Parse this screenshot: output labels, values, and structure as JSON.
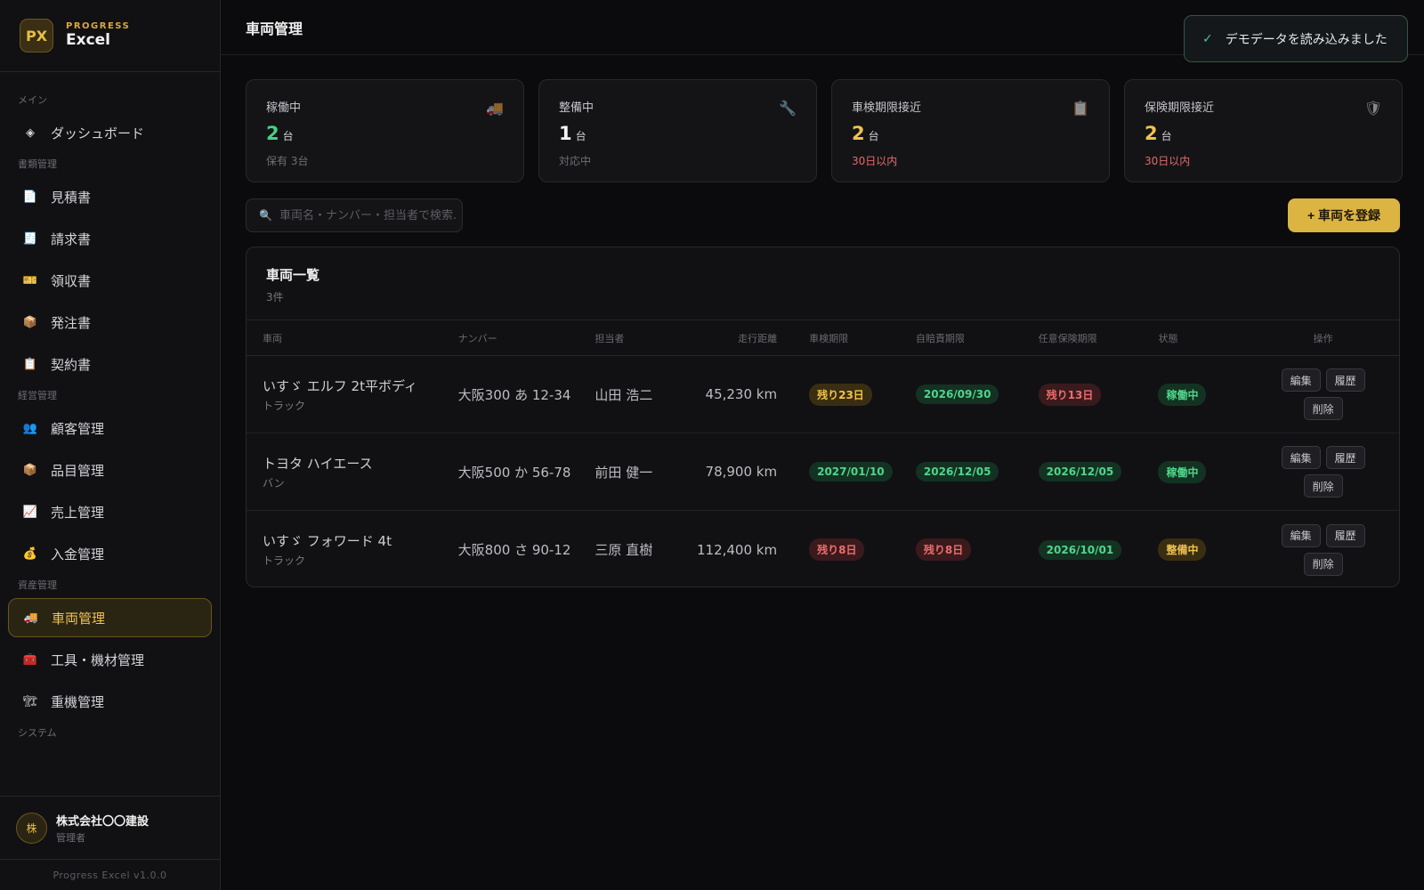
{
  "brand": {
    "logo": "PX",
    "eyebrow": "PROGRESS",
    "name": "Excel"
  },
  "sidebar": {
    "sections": [
      {
        "label": "メイン",
        "items": [
          {
            "icon": "◈",
            "icon_name": "dashboard-icon",
            "label": "ダッシュボード"
          }
        ]
      },
      {
        "label": "書類管理",
        "items": [
          {
            "icon": "📄",
            "icon_name": "document-icon",
            "label": "見積書"
          },
          {
            "icon": "🧾",
            "icon_name": "invoice-icon",
            "label": "請求書"
          },
          {
            "icon": "🎫",
            "icon_name": "receipt-icon",
            "label": "領収書"
          },
          {
            "icon": "📦",
            "icon_name": "package-icon",
            "label": "発注書"
          },
          {
            "icon": "📋",
            "icon_name": "clipboard-icon",
            "label": "契約書"
          }
        ]
      },
      {
        "label": "経営管理",
        "items": [
          {
            "icon": "👥",
            "icon_name": "customers-icon",
            "label": "顧客管理"
          },
          {
            "icon": "📦",
            "icon_name": "package-icon",
            "label": "品目管理"
          },
          {
            "icon": "📈",
            "icon_name": "chart-icon",
            "label": "売上管理"
          },
          {
            "icon": "💰",
            "icon_name": "money-bag-icon",
            "label": "入金管理"
          }
        ]
      },
      {
        "label": "資産管理",
        "items": [
          {
            "icon": "🚚",
            "icon_name": "truck-icon",
            "label": "車両管理",
            "active": true
          },
          {
            "icon": "🧰",
            "icon_name": "toolbox-icon",
            "label": "工具・機材管理"
          },
          {
            "icon": "🏗",
            "icon_name": "crane-icon",
            "label": "重機管理"
          }
        ]
      },
      {
        "label": "システム",
        "items": []
      }
    ]
  },
  "user": {
    "avatar": "株",
    "name": "株式会社〇〇建設",
    "role": "管理者"
  },
  "version": "Progress Excel v1.0.0",
  "header": {
    "title": "車両管理"
  },
  "toast": {
    "icon": "✓",
    "message": "デモデータを読み込みました"
  },
  "stats": [
    {
      "label": "稼働中",
      "icon": "🚚",
      "icon_name": "truck-icon",
      "value": "2",
      "unit": "台",
      "sub": "保有 3台",
      "value_color": "green",
      "sub_alert": false
    },
    {
      "label": "整備中",
      "icon": "🔧",
      "icon_name": "wrench-icon",
      "value": "1",
      "unit": "台",
      "sub": "対応中",
      "value_color": "white",
      "sub_alert": false
    },
    {
      "label": "車検期限接近",
      "icon": "📋",
      "icon_name": "clipboard-icon",
      "value": "2",
      "unit": "台",
      "sub": "30日以内",
      "value_color": "amber",
      "sub_alert": true
    },
    {
      "label": "保険期限接近",
      "icon": "🛡",
      "icon_name": "shield-icon",
      "value": "2",
      "unit": "台",
      "sub": "30日以内",
      "value_color": "amber",
      "sub_alert": true
    }
  ],
  "search": {
    "placeholder": "車両名・ナンバー・担当者で検索..."
  },
  "add_button": {
    "label": "+ 車両を登録"
  },
  "table": {
    "title": "車両一覧",
    "count": "3件",
    "columns": [
      "車両",
      "ナンバー",
      "担当者",
      "走行距離",
      "車検期限",
      "自賠責期限",
      "任意保険期限",
      "状態",
      "操作"
    ],
    "actions": [
      "編集",
      "履歴",
      "削除"
    ],
    "rows": [
      {
        "name": "いすゞ エルフ 2t平ボディ",
        "type": "トラック",
        "plate": "大阪300 あ 12-34",
        "manager": "山田 浩二",
        "mileage": "45,230 km",
        "inspection": {
          "text": "残り23日",
          "tone": "amber"
        },
        "jibai": {
          "text": "2026/09/30",
          "tone": "green"
        },
        "insurance": {
          "text": "残り13日",
          "tone": "red"
        },
        "status": {
          "text": "稼働中",
          "tone": "green"
        }
      },
      {
        "name": "トヨタ ハイエース",
        "type": "バン",
        "plate": "大阪500 か 56-78",
        "manager": "前田 健一",
        "mileage": "78,900 km",
        "inspection": {
          "text": "2027/01/10",
          "tone": "green"
        },
        "jibai": {
          "text": "2026/12/05",
          "tone": "green"
        },
        "insurance": {
          "text": "2026/12/05",
          "tone": "green"
        },
        "status": {
          "text": "稼働中",
          "tone": "green"
        }
      },
      {
        "name": "いすゞ フォワード 4t",
        "type": "トラック",
        "plate": "大阪800 さ 90-12",
        "manager": "三原 直樹",
        "mileage": "112,400 km",
        "inspection": {
          "text": "残り8日",
          "tone": "red"
        },
        "jibai": {
          "text": "残り8日",
          "tone": "red"
        },
        "insurance": {
          "text": "2026/10/01",
          "tone": "green"
        },
        "status": {
          "text": "整備中",
          "tone": "amber"
        }
      }
    ]
  },
  "colors": {
    "accent": "#dcb442",
    "green": "#4fd58b",
    "red": "#ec6d6d",
    "amber": "#f0c24e"
  }
}
